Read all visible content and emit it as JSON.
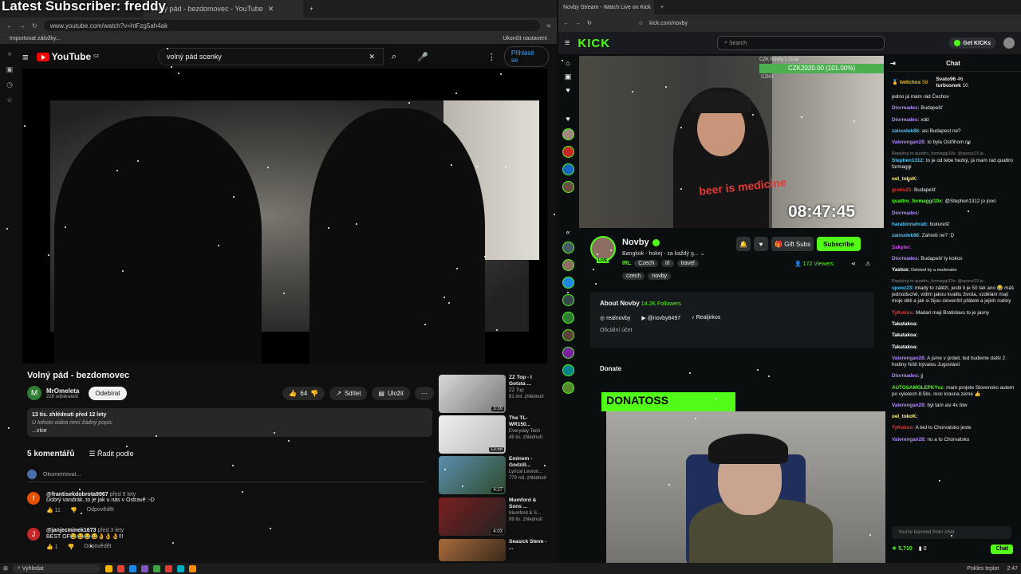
{
  "overlay": {
    "title": "Latest Subscriber: freddy"
  },
  "youtube": {
    "tab_title": "Volný pád - bezdomovec - YouTube",
    "url": "www.youtube.com/watch?v=htFzg5ah4ak",
    "bookmark_left": "Importovat záložky...",
    "bookmark_right": "Ukončit nastavení",
    "logo": "YouTube",
    "logo_region": "CZ",
    "search_value": "volný pád scenky",
    "signin": "Přihlásit se",
    "video_title": "Volný pád - bezdomovec",
    "channel": {
      "initial": "M",
      "name": "MrOmeleta",
      "subs": "228 odběratelů",
      "subscribe": "Odebírat"
    },
    "likes": "64",
    "share": "Sdílet",
    "save": "Uložit",
    "desc_stats": "13 tis. zhlédnutí  před 12 lety",
    "desc_text": "U tohoto videa není žádný popis.",
    "desc_more": "...více",
    "comments_count": "5 komentářů",
    "sort": "Řadit podle",
    "add_comment": "Okomentovat...",
    "comments": [
      {
        "initial": "f",
        "color": "#e65100",
        "user": "@frantisekdobrota9967",
        "time": "před 5 lety",
        "text": "Dobrý vandrák..to je jak u nás v Ostravě :-D",
        "likes": "11",
        "reply": "Odpovědět"
      },
      {
        "initial": "J",
        "color": "#c62828",
        "user": "@janjecminek1673",
        "time": "před 3 lety",
        "text": "BEST OF😂😂😂😂👌👌👌!!!",
        "likes": "1",
        "reply": "Odpovědět"
      }
    ],
    "recommended": [
      {
        "title": "ZZ Top - I Gotsta ...",
        "channel": "ZZ Top",
        "views": "61 mil. zhlédnutí",
        "dur": "3:39"
      },
      {
        "title": "The TL-WR150...",
        "channel": "Everyday Tech",
        "views": "45 tis. zhlédnutí",
        "dur": "13:58"
      },
      {
        "title": "Eminem - Godzill...",
        "channel": "Lyrical Lemon...",
        "views": "779 mil. zhlédnutí",
        "dur": "4:27"
      },
      {
        "title": "Mumford & Sons ...",
        "channel": "Mumford & S...",
        "views": "99 tis. zhlédnutí",
        "dur": "4:03"
      },
      {
        "title": "Seasick Steve - ...",
        "channel": "",
        "views": "",
        "dur": ""
      }
    ]
  },
  "kick": {
    "tab_title": "Novby Stream - Watch Live on Kick",
    "url": "kick.com/novby",
    "logo": "KICK",
    "search_placeholder": "Search",
    "get_kicks": "Get KICKs",
    "goal_top": "CZK Novby's Goal",
    "goal": "CZK2020.00 (101.00%)",
    "goal_small": "CZK0",
    "timer": "08:47:45",
    "shirt": "beer is medicine",
    "channel_name": "Novby",
    "stream_title": "Bangkok - hokej - za každý g...",
    "tags": [
      "IRL",
      "Czech",
      "irl",
      "travel"
    ],
    "tags2": [
      "czech",
      "novby"
    ],
    "live": "LIVE",
    "gift": "Gift Subs",
    "subscribe": "Subscribe",
    "viewers": "172 Viewers",
    "about_title": "About Novby",
    "followers": "14.2K Followers",
    "links": [
      "realnovby",
      "@novby8497",
      "Realjirkos"
    ],
    "official": "Oficiální účet",
    "donate": "Donate",
    "donate_banner": "DONATOSS",
    "chat": {
      "title": "Chat",
      "pinned": [
        {
          "name": "twitchos",
          "count": "58"
        },
        {
          "name": "Svato96",
          "count": "46"
        },
        {
          "name": "turbosnek",
          "count": "10"
        }
      ],
      "messages": [
        {
          "u": "",
          "c": "#fff",
          "t": "jedno já mám rád Čechov"
        },
        {
          "u": "Diormades:",
          "c": "#b388ff",
          "t": "Budapešť"
        },
        {
          "u": "Diormades:",
          "c": "#b388ff",
          "t": "xdd"
        },
        {
          "u": "zaloudek86:",
          "c": "#4fc3f7",
          "t": "asi Budapest ne?"
        },
        {
          "u": "Valerengan28:",
          "c": "#b388ff",
          "t": "to byla Ostřihom ne"
        },
        {
          "u": "",
          "c": "#888",
          "t": "Replying to quattro_formaggi10x: @spooz23 je..",
          "r": true
        },
        {
          "u": "Stephen1312:",
          "c": "#4fc3f7",
          "t": "to je od tebe hezký, já mam rad quattro formaggi"
        },
        {
          "u": "oel_tokoK:",
          "c": "#fff176",
          "t": ""
        },
        {
          "u": "gratis23:",
          "c": "#e53935",
          "t": "Budapešť"
        },
        {
          "u": "quattro_formaggi10x:",
          "c": "#53fc18",
          "t": "@Stephen1312 jo jooo"
        },
        {
          "u": "Diormades:",
          "c": "#b388ff",
          "t": ""
        },
        {
          "u": "harabinnahrab:",
          "c": "#4fc3f7",
          "t": "bukurešť"
        },
        {
          "u": "zaloudek86:",
          "c": "#4fc3f7",
          "t": "Zahreb ne? :D"
        },
        {
          "u": "Sakyler:",
          "c": "#e040fb",
          "t": ""
        },
        {
          "u": "Diormades:",
          "c": "#b388ff",
          "t": "Budapešť ty kokos"
        },
        {
          "u": "Yastus:",
          "c": "#fff",
          "t": "Deleted by a moderator"
        },
        {
          "u": "",
          "c": "#888",
          "t": "Replying to quattro_formaggi10x: @spooz23 je..",
          "r": true
        },
        {
          "u": "spooz23:",
          "c": "#4fc3f7",
          "t": "mladý to zálěží, jestli ti je 50 tak ano 😂 máš jednoduché, vidím jakou kvalitu života, vzdělání mají moje děti a jak si žijou slovenští přátelé a jejich rodiny"
        },
        {
          "u": "TyKokos:",
          "c": "#e53935",
          "t": "Madari maji Bratislavu to je jasny"
        },
        {
          "u": "Takatakoa:",
          "c": "#fff",
          "t": ""
        },
        {
          "u": "Takatakoa:",
          "c": "#fff",
          "t": ""
        },
        {
          "u": "Takatakoa:",
          "c": "#fff",
          "t": ""
        },
        {
          "u": "Valerengan28:",
          "c": "#b388ff",
          "t": "A jsme v prdeli, ted budeme další 2 hodiny řešit bývalou Jugoslávii"
        },
        {
          "u": "Diormades:",
          "c": "#b388ff",
          "t": "jj"
        },
        {
          "u": "AUTOSAMOLEPKYcz:",
          "c": "#53fc18",
          "t": "mam projete Slovensko autem po vyletech 8.5tis. moc krasna zeme 👍"
        },
        {
          "u": "Valerengan28:",
          "c": "#b388ff",
          "t": "byl tam asi 4x btw"
        },
        {
          "u": "oel_tokoK:",
          "c": "#fff176",
          "t": ""
        },
        {
          "u": "TyKokos:",
          "c": "#e53935",
          "t": "A ted to Chorvatsko jeste"
        },
        {
          "u": "Valerengan28:",
          "c": "#b388ff",
          "t": "no a to Chorvatsko"
        }
      ],
      "banned": "You're banned from chat",
      "kicks": "5,710",
      "zero": "0",
      "send": "Chat"
    }
  },
  "taskbar": {
    "search": "Vyhledat",
    "weather": "Pokles teplot",
    "time": "2:47"
  }
}
